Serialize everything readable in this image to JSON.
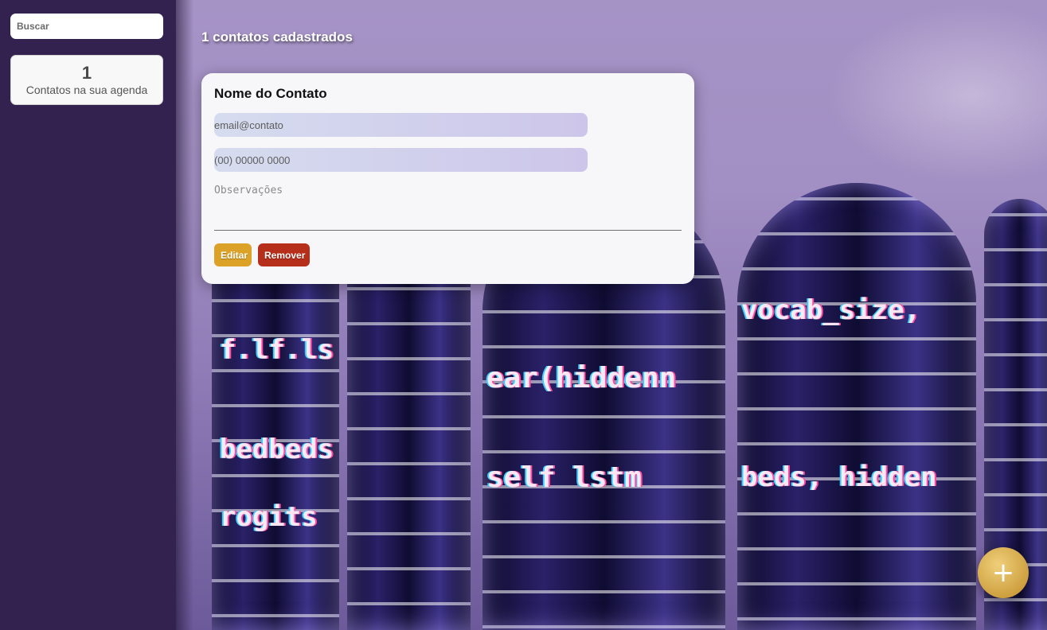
{
  "sidebar": {
    "search": {
      "placeholder": "Buscar"
    },
    "summary": {
      "count": "1",
      "label": "Contatos na sua agenda"
    }
  },
  "main": {
    "heading": "1 contatos cadastrados",
    "contact": {
      "name": "Nome do Contato",
      "email_placeholder": "email@contato",
      "phone_placeholder": "(00) 00000 0000",
      "notes_placeholder": "Observações",
      "edit_label": "Editar",
      "remove_label": "Remover"
    },
    "add_button": {
      "icon": "plus-icon",
      "label": "+"
    }
  },
  "colors": {
    "sidebar": "#33214f",
    "edit": "#dba227",
    "remove": "#b52f1a",
    "fab": "#d4a94c"
  }
}
